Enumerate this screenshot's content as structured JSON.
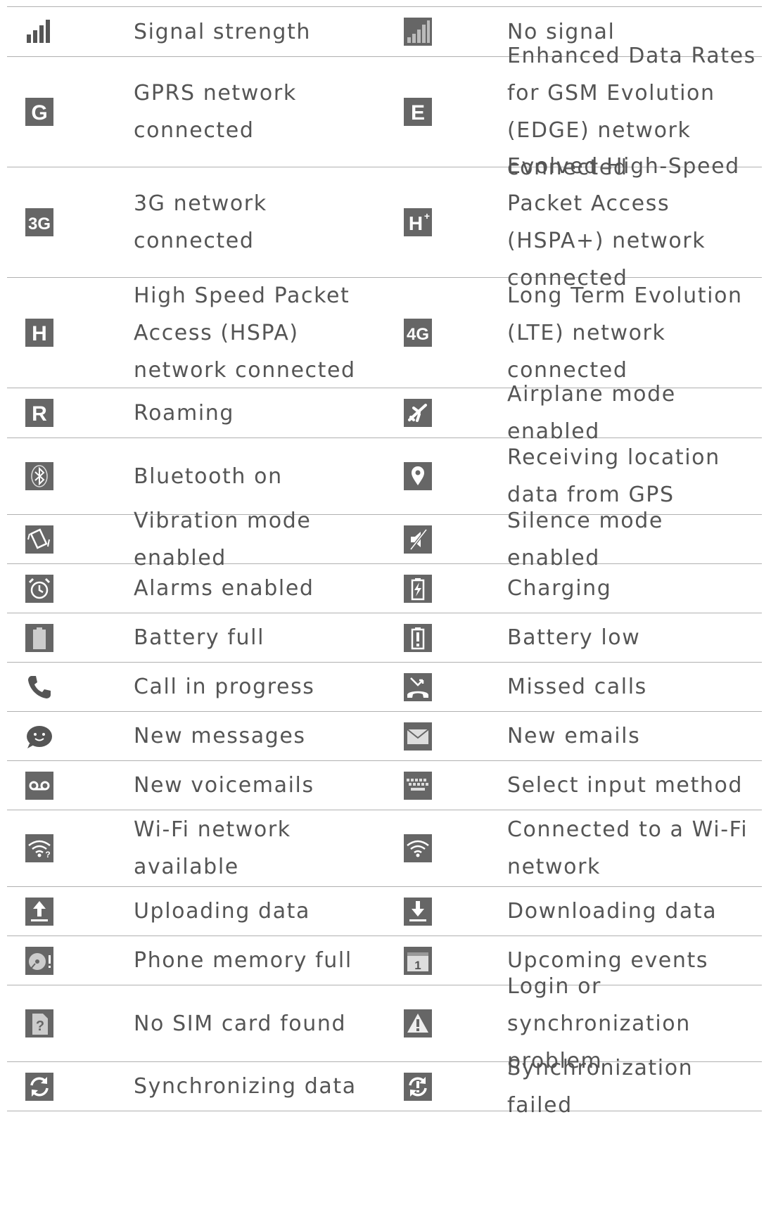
{
  "rows": [
    {
      "left": {
        "icon": "signal-strength-icon",
        "label": "Signal strength"
      },
      "right": {
        "icon": "no-signal-icon",
        "label": "No signal"
      }
    },
    {
      "left": {
        "icon": "gprs-icon",
        "label": "GPRS network connected"
      },
      "right": {
        "icon": "edge-icon",
        "label": "Enhanced Data Rates for GSM Evolution (EDGE) network connected"
      }
    },
    {
      "left": {
        "icon": "3g-icon",
        "label": "3G network connected"
      },
      "right": {
        "icon": "hspa-plus-icon",
        "label": "Evolved High-Speed Packet Access (HSPA+) network connected"
      }
    },
    {
      "left": {
        "icon": "hspa-icon",
        "label": "High Speed Packet Access (HSPA) network connected"
      },
      "right": {
        "icon": "4g-icon",
        "label": "Long Term Evolution (LTE) network connected"
      }
    },
    {
      "left": {
        "icon": "roaming-icon",
        "label": "Roaming"
      },
      "right": {
        "icon": "airplane-icon",
        "label": "Airplane mode enabled"
      }
    },
    {
      "left": {
        "icon": "bluetooth-icon",
        "label": "Bluetooth on"
      },
      "right": {
        "icon": "gps-location-icon",
        "label": "Receiving location data from GPS"
      }
    },
    {
      "left": {
        "icon": "vibration-icon",
        "label": "Vibration mode enabled"
      },
      "right": {
        "icon": "silence-icon",
        "label": "Silence mode enabled"
      }
    },
    {
      "left": {
        "icon": "alarm-icon",
        "label": "Alarms enabled"
      },
      "right": {
        "icon": "charging-icon",
        "label": "Charging"
      }
    },
    {
      "left": {
        "icon": "battery-full-icon",
        "label": "Battery full"
      },
      "right": {
        "icon": "battery-low-icon",
        "label": "Battery low"
      }
    },
    {
      "left": {
        "icon": "call-icon",
        "label": "Call in progress"
      },
      "right": {
        "icon": "missed-call-icon",
        "label": "Missed calls"
      }
    },
    {
      "left": {
        "icon": "message-icon",
        "label": "New messages"
      },
      "right": {
        "icon": "email-icon",
        "label": "New emails"
      }
    },
    {
      "left": {
        "icon": "voicemail-icon",
        "label": "New voicemails"
      },
      "right": {
        "icon": "keyboard-icon",
        "label": "Select input method"
      }
    },
    {
      "left": {
        "icon": "wifi-available-icon",
        "label": "Wi-Fi network available"
      },
      "right": {
        "icon": "wifi-connected-icon",
        "label": "Connected to a Wi-Fi network"
      }
    },
    {
      "left": {
        "icon": "upload-icon",
        "label": "Uploading data"
      },
      "right": {
        "icon": "download-icon",
        "label": "Downloading data"
      }
    },
    {
      "left": {
        "icon": "memory-full-icon",
        "label": "Phone memory full"
      },
      "right": {
        "icon": "calendar-icon",
        "label": "Upcoming events"
      }
    },
    {
      "left": {
        "icon": "no-sim-icon",
        "label": "No SIM card found"
      },
      "right": {
        "icon": "warning-icon",
        "label": "Login or synchronization problem"
      }
    },
    {
      "left": {
        "icon": "sync-icon",
        "label": "Synchronizing data"
      },
      "right": {
        "icon": "sync-failed-icon",
        "label": "Synchronization failed"
      }
    }
  ]
}
